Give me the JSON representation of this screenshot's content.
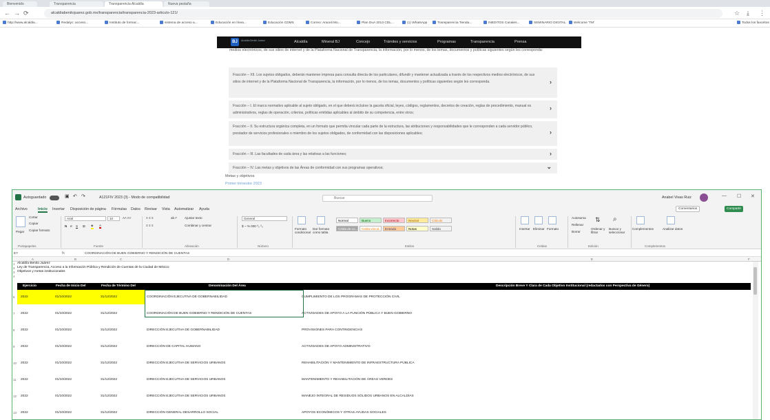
{
  "browser": {
    "tabs": [
      "Bienvenido",
      "Transparencia",
      "Transparencia Alcaldía",
      "Nueva pestaña"
    ],
    "url": "alcaldiabenitojuarez.gob.mx/transparencia/transparencia-2023-articulo-121/",
    "bookmarks": [
      "http://www.alcaldia...",
      "Redalyc: acceso...",
      "Instituto de formac...",
      "sistema de acceso a...",
      "Educación en línea...",
      "Educación CDMX",
      "Correo: Araceli Mo...",
      "Plan DuA 2013 CDL...",
      "(1) WhatsApp",
      "Transparencia Tienda...",
      "INEDITOS Canales...",
      "SEMINARIO DIGITAL",
      "Welcome 'TM'",
      "Todos los favoritos"
    ]
  },
  "site": {
    "logo": "BJ",
    "logo_sub": "Alcaldía Benito Juárez",
    "nav": [
      "Alcaldía",
      "Mineral BJ",
      "Concejo",
      "Trámites y servicios",
      "Programas",
      "Transparencia",
      "Prensa"
    ],
    "intro": "medios electrónicos, de sus sitios de internet y de la Plataforma Nacional de Transparencia, la información, por lo menos, de los temas, documentos y políticas siguientes según les corresponda:",
    "accordions": [
      {
        "text": "Fracción – XII. Los sujetos obligados, deberán mantener impresa para consulta directa de los particulares, difundir y mantener actualizada a través de los respectivos medios electrónicos, de sus sitios de internet y de la Plataforma Nacional de Transparencia, la información, por lo menos, de los temas, documentos y políticas siguientes según les corresponda.",
        "chev": "›"
      },
      {
        "text": "Fracción – I. El marco normativo aplicable al sujeto obligado, en el que deberá incluirse la gaceta oficial, leyes, códigos, reglamentos, decretos de creación, reglas de procedimiento, manual es administrativos, reglas de operación, criterios, políticas emitidas aplicables al ámbito de su competencia, entre otros;",
        "chev": "›"
      },
      {
        "text": "Fracción – II. Su estructura orgánica completa, en un formato que permita vincular cada parte de la estructura, las atribuciones y responsabilidades que le corresponden a cada servidor público, prestador de servicios profesionales o miembro de los sujetos obligados, de conformidad con las disposiciones aplicables;",
        "chev": "›"
      },
      {
        "text": "Fracción – III. Las facultades de cada área y las relativas a las funciones;",
        "chev": "›"
      },
      {
        "text": "Fracción – IV. Las metas y objetivos de las Áreas de conformidad con sus programas operativos;",
        "chev": "⌄"
      }
    ],
    "metas": "Metas y objetivos",
    "trimestre": "Primer trimestre 2023"
  },
  "excel": {
    "autosave": "Autoguardado",
    "filename": "A121FIV 2023 (3) - Modo de compatibilidad",
    "search": "Buscar",
    "user": "Anabel Vivas Ruiz",
    "menu": [
      "Archivo",
      "Inicio",
      "Insertar",
      "Disposición de página",
      "Fórmulas",
      "Datos",
      "Revisar",
      "Vista",
      "Automatizar",
      "Ayuda"
    ],
    "comments": "Comentarios",
    "share": "Compartir",
    "ribbon": {
      "groups": [
        "Portapapeles",
        "Fuente",
        "Alineación",
        "Número",
        "Estilos",
        "Celdas",
        "Edición",
        "Complementos"
      ],
      "paste": "Pegar",
      "cut": "Cortar",
      "copy": "Copiar",
      "format_painter": "Copiar formato",
      "font": "Arial",
      "size": "10",
      "wrap": "Ajustar texto",
      "merge": "Combinar y centrar",
      "number_format": "General",
      "conditional": "Formato condicional",
      "as_table": "Dar formato como tabla",
      "styles": [
        {
          "label": "Normal",
          "bg": "#ffffff",
          "fg": "#000000"
        },
        {
          "label": "Bueno",
          "bg": "#c6efce",
          "fg": "#006100"
        },
        {
          "label": "Incorrecto",
          "bg": "#ffc7ce",
          "fg": "#9c0006"
        },
        {
          "label": "Neutral",
          "bg": "#ffeb9c",
          "fg": "#9c5700"
        },
        {
          "label": "Cálculo",
          "bg": "#f2f2f2",
          "fg": "#fa7d00"
        },
        {
          "label": "Celda de co...",
          "bg": "#a5a5a5",
          "fg": "#ffffff"
        },
        {
          "label": "Celda vincul...",
          "bg": "#ffffff",
          "fg": "#fa7d00"
        },
        {
          "label": "Entrada",
          "bg": "#ffcc99",
          "fg": "#3f3f76"
        },
        {
          "label": "Notas",
          "bg": "#ffffcc",
          "fg": "#000000"
        },
        {
          "label": "Salida",
          "bg": "#f2f2f2",
          "fg": "#3f3f3f"
        }
      ],
      "insert": "Insertar",
      "delete": "Eliminar",
      "format": "Formato",
      "autosum": "Autosuma",
      "fill": "Rellenar",
      "clear": "Borrar",
      "sort": "Ordenar y filtrar",
      "find": "Buscar y seleccionar",
      "addins": "Complementos",
      "analyze": "Analizar datos"
    },
    "namebox": "E7",
    "fx": "fx",
    "formula": "COORDINACIÓN DE BUEN GOBIERNO Y RENDICIÓN DE CUENTAS",
    "columns": [
      "A",
      "B",
      "C",
      "D",
      "E",
      "F"
    ],
    "header_lines": [
      "Alcaldía Benito Juárez",
      "Ley de Transparencia, Acceso a la Información Pública y Rendición de Cuentas de la Ciudad de México",
      "Objetivos y metas institucionales"
    ],
    "header_rownums": [
      "1",
      "2",
      "3",
      "4"
    ],
    "table_headers": [
      "Ejercicio",
      "Fecha de Inicio Del",
      "Fecha de Término Del",
      "Denominación Del Área",
      "Descripción Breve Y Clara de Cada Objetivo Institucional (redactados con Perspectiva de Género)"
    ],
    "rows": [
      {
        "n": "6",
        "year": "2022",
        "start": "01/10/2022",
        "end": "31/12/2022",
        "area": "COORDINACIÓN EJECUTIVA DE GOBERNABILIDAD",
        "desc": "CUMPLIMIENTO DE LOS PROGRAMAS DE PROTECCIÓN CIVIL",
        "highlight": true
      },
      {
        "n": "7",
        "year": "2022",
        "start": "01/10/2022",
        "end": "31/12/2022",
        "area": "COORDINACIÓN DE BUEN GOBIERNO Y RENDICIÓN DE CUENTAS",
        "desc": "ACTIVIDADES DE APOYO A LA FUNCIÓN PÚBLICA Y BUEN GOBIERNO",
        "highlight": false
      },
      {
        "n": "8",
        "year": "2022",
        "start": "01/10/2022",
        "end": "31/12/2022",
        "area": "DIRECCIÓN EJECUTIVA DE GOBERNABILIDAD",
        "desc": "PROVISIONES PARA CONTINGENCIAS",
        "highlight": false
      },
      {
        "n": "9",
        "year": "2022",
        "start": "01/10/2022",
        "end": "31/12/2022",
        "area": "DIRECCIÓN DE CAPITAL HUMANO",
        "desc": "ACTIVIDADES DE APOYO ADMINISTRATIVO",
        "highlight": false
      },
      {
        "n": "10",
        "year": "2022",
        "start": "01/10/2022",
        "end": "31/12/2022",
        "area": "DIRECCIÓN EJECUTIVA DE SERVICIOS URBANOS",
        "desc": "REHABILITACIÓN Y MANTENIMIENTO DE INFRAESTRUCTURA PÚBLICA",
        "highlight": false
      },
      {
        "n": "11",
        "year": "2022",
        "start": "01/10/2022",
        "end": "31/12/2022",
        "area": "DIRECCIÓN EJECUTIVA DE SERVICIOS URBANOS",
        "desc": "MANTENIMIENTO Y REHABILITACIÓN DE ÁREAS VERDES",
        "highlight": false
      },
      {
        "n": "12",
        "year": "2022",
        "start": "01/10/2022",
        "end": "31/12/2022",
        "area": "DIRECCIÓN EJECUTIVA DE SERVICIOS URBANOS",
        "desc": "MANEJO INTEGRAL DE RESIDUOS SÓLIDOS URBANOS EN ALCALDÍAS",
        "highlight": false
      },
      {
        "n": "13",
        "year": "2022",
        "start": "01/10/2022",
        "end": "31/12/2022",
        "area": "DIRECCIÓN GENERAL DESARROLLO SOCIAL",
        "desc": "APOYOS ECONÓMICOS Y OTRAS AYUDAS SOCIALES",
        "highlight": false
      }
    ],
    "colors": {
      "highlight": "#ffff00",
      "accent": "#217346",
      "share": "#2f8c4f"
    }
  }
}
